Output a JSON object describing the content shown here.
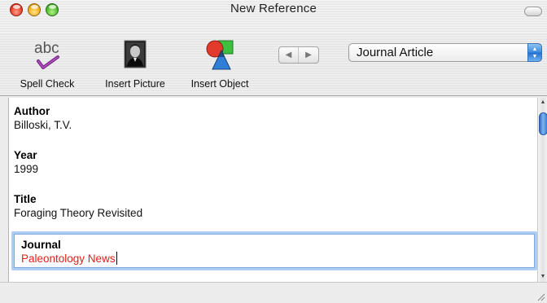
{
  "window": {
    "title": "New Reference"
  },
  "toolbar": {
    "spell_check": {
      "label": "Spell Check",
      "icon": "spell-check-icon",
      "icon_text": "abc"
    },
    "insert_picture": {
      "label": "Insert Picture",
      "icon": "portrait-icon"
    },
    "insert_object": {
      "label": "Insert Object",
      "icon": "shapes-icon"
    },
    "nav": {
      "prev_glyph": "◀",
      "next_glyph": "▶"
    },
    "reference_type": {
      "selected": "Journal Article",
      "arrows": "▲▼"
    }
  },
  "fields": [
    {
      "label": "Author",
      "value": "Billoski, T.V."
    },
    {
      "label": "Year",
      "value": "1999"
    },
    {
      "label": "Title",
      "value": "Foraging Theory Revisited"
    },
    {
      "label": "Journal",
      "value": "Paleontology News",
      "focused": true
    }
  ],
  "scrollbar": {
    "up_glyph": "▲",
    "down_glyph": "▼"
  },
  "colors": {
    "focused_value_text": "#e0201d",
    "focus_ring": "#aecdf2",
    "select_accent": "#3a8ae0"
  }
}
